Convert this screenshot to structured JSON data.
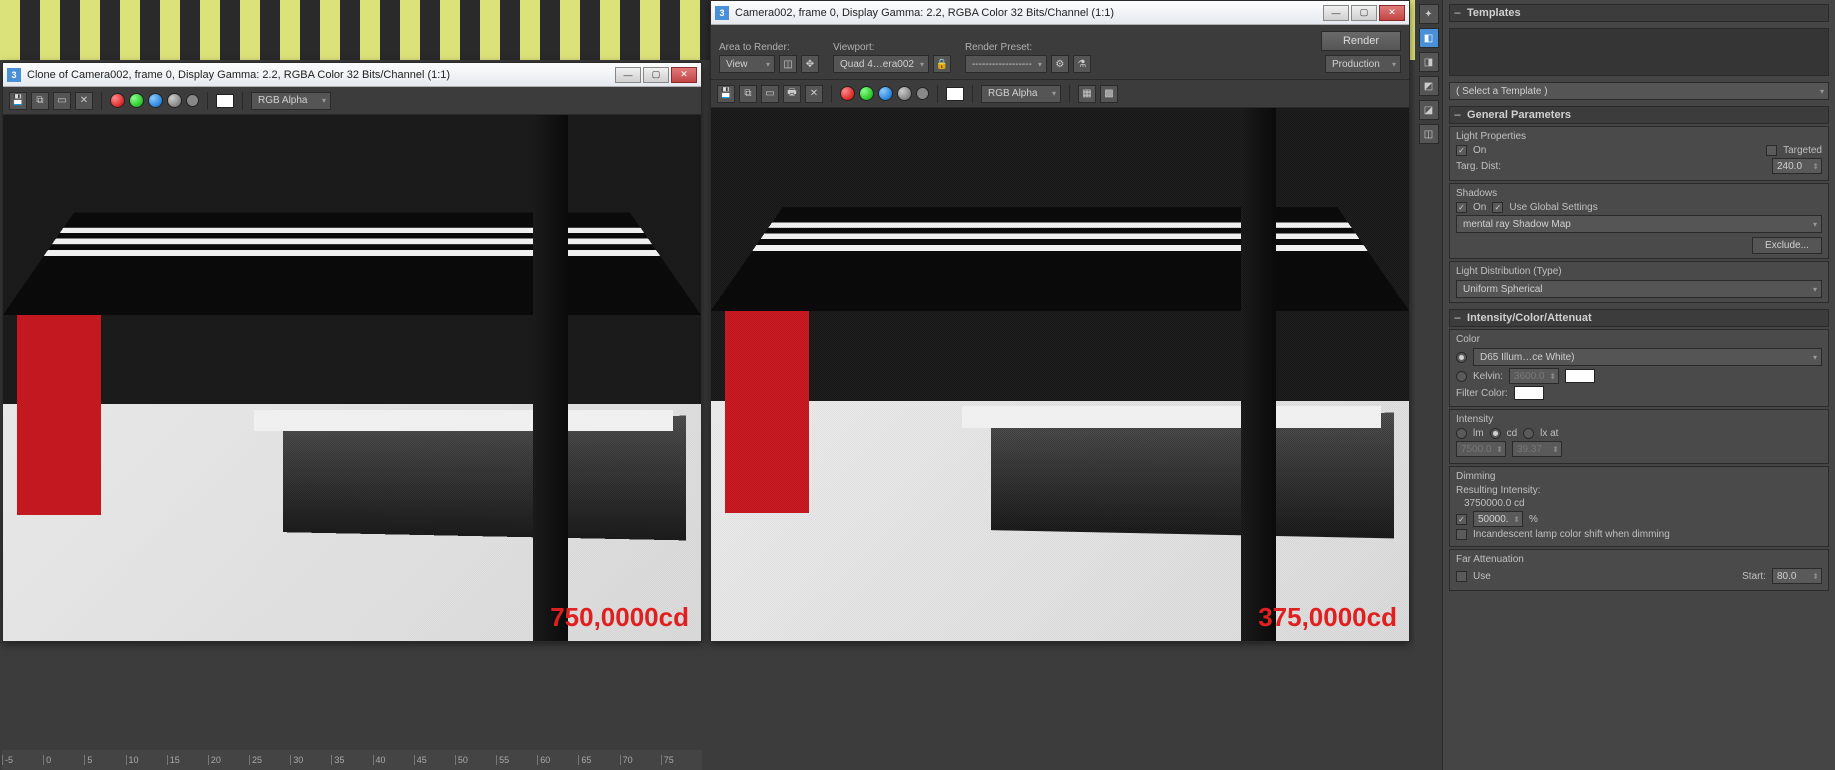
{
  "windowLeft": {
    "title": "Clone of Camera002, frame 0, Display Gamma: 2.2, RGBA Color 32 Bits/Channel (1:1)",
    "channelDropdown": "RGB Alpha",
    "overlay": "750,0000cd"
  },
  "windowRight": {
    "title": "Camera002, frame 0, Display Gamma: 2.2, RGBA Color 32 Bits/Channel (1:1)",
    "channelDropdown": "RGB Alpha",
    "overlay": "375,0000cd",
    "setup": {
      "areaLabel": "Area to Render:",
      "areaValue": "View",
      "viewportLabel": "Viewport:",
      "viewportValue": "Quad 4…era002",
      "presetLabel": "Render Preset:",
      "presetValue": "------------------",
      "renderBtn": "Render",
      "modeValue": "Production"
    }
  },
  "ruler": [
    "-5",
    "0",
    "5",
    "10",
    "15",
    "20",
    "25",
    "30",
    "35",
    "40",
    "45",
    "50",
    "55",
    "60",
    "65",
    "70",
    "75"
  ],
  "panel": {
    "templatesHeader": "Templates",
    "templatePlaceholder": "( Select a Template )",
    "generalHeader": "General Parameters",
    "lightPropsLabel": "Light Properties",
    "onLabel": "On",
    "targetedLabel": "Targeted",
    "targDistLabel": "Targ. Dist:",
    "targDistVal": "240.0",
    "shadowsLabel": "Shadows",
    "useGlobalLabel": "Use Global Settings",
    "shadowTypeVal": "mental ray Shadow Map",
    "excludeBtn": "Exclude...",
    "distLabel": "Light Distribution (Type)",
    "distVal": "Uniform Spherical",
    "intensityHeader": "Intensity/Color/Attenuat",
    "colorLabel": "Color",
    "colorPreset": "D65 Illum…ce White)",
    "kelvinLabel": "Kelvin:",
    "kelvinVal": "3600.0",
    "filterLabel": "Filter Color:",
    "intensityLabel": "Intensity",
    "lmLabel": "lm",
    "cdLabel": "cd",
    "lxLabel": "lx at",
    "intVal1": "7500.0",
    "intVal2": "39.37",
    "dimmingLabel": "Dimming",
    "resultLabel": "Resulting Intensity:",
    "resultVal": "3750000.0 cd",
    "dimPct": "50000.",
    "pctSym": "%",
    "incandLabel": "Incandescent lamp color shift when dimming",
    "farAttenLabel": "Far Attenuation",
    "useLabel": "Use",
    "startLabel": "Start:",
    "startVal": "80.0"
  }
}
